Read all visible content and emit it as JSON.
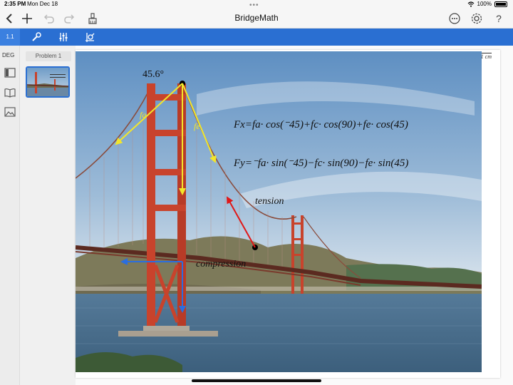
{
  "status": {
    "time": "2:35 PM",
    "date": "Mon Dec 18",
    "battery": "100%"
  },
  "nav": {
    "title": "BridgeMath",
    "icons": [
      "back-icon",
      "add-icon",
      "undo-icon",
      "redo-icon",
      "clear-icon",
      "more-icon",
      "settings-icon",
      "help-icon"
    ]
  },
  "toolbar": {
    "page_number": "1.1",
    "icons": [
      "wrench-icon",
      "sliders-icon",
      "graph-tools-icon"
    ]
  },
  "rail": {
    "angle_mode": "DEG"
  },
  "thumbs": {
    "problem_label": "Problem 1"
  },
  "canvas": {
    "scale_label": "1 cm",
    "angle_label": "45.6°",
    "force_label_a": "fa",
    "force_label_e": "fe",
    "equation_fx": "Fx=fa· cos(⁻45)+fc· cos(90)+fe· cos(45)",
    "equation_fy": "Fy=⁻fa· sin(⁻45)−fc· sin(90)−fe· sin(45)",
    "tension_label": "tension",
    "compression_label": "compression"
  },
  "colors": {
    "accent": "#2a6fd2",
    "tower": "#c8432c",
    "force_yellow": "#f3e62a",
    "tension_red": "#e01818",
    "compression_blue": "#2a6ee0"
  }
}
